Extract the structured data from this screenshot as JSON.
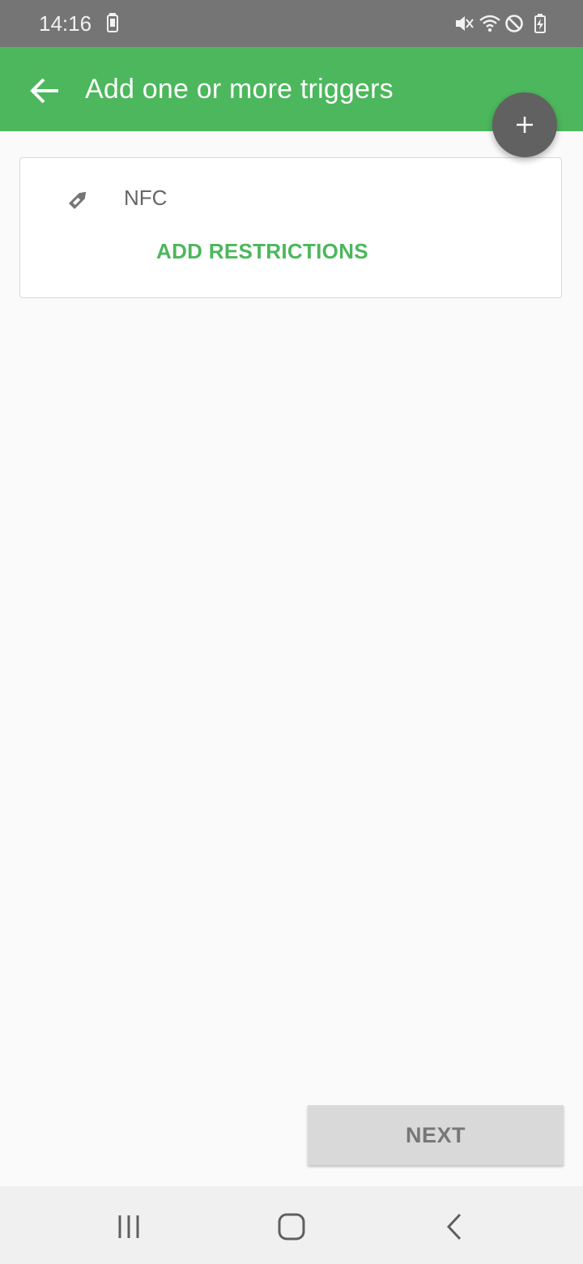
{
  "status_bar": {
    "time": "14:16",
    "icons": [
      "phone-vibrate-icon",
      "mute-icon",
      "wifi-icon",
      "blocked-icon",
      "battery-charging-icon"
    ]
  },
  "app_bar": {
    "title": "Add one or more triggers",
    "back_icon": "arrow-left-icon",
    "fab_icon": "plus-icon"
  },
  "triggers": [
    {
      "icon": "tag-icon",
      "label": "NFC",
      "action_label": "ADD RESTRICTIONS"
    }
  ],
  "footer": {
    "next_label": "NEXT"
  },
  "nav_bar": {
    "icons": [
      "recent-apps-icon",
      "home-icon",
      "back-icon"
    ]
  },
  "colors": {
    "accent": "#4cb75c",
    "status_bar": "#757575",
    "fab": "#616161",
    "next_button": "#d9d9d9"
  }
}
